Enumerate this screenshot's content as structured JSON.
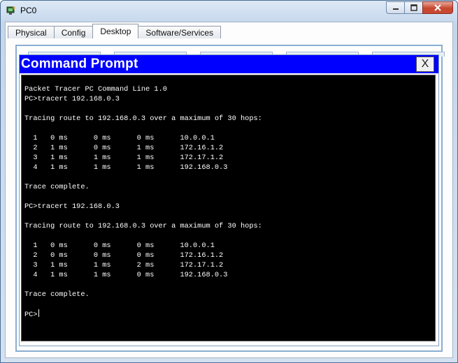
{
  "window": {
    "title": "PC0",
    "icon": "packet-tracer-pc-icon"
  },
  "tabs": [
    {
      "label": "Physical"
    },
    {
      "label": "Config"
    },
    {
      "label": "Desktop",
      "active": true
    },
    {
      "label": "Software/Services"
    }
  ],
  "command_prompt": {
    "title": "Command Prompt",
    "close_label": "X",
    "lines": [
      "Packet Tracer PC Command Line 1.0",
      "PC>tracert 192.168.0.3",
      "",
      "Tracing route to 192.168.0.3 over a maximum of 30 hops:",
      "",
      "  1   0 ms      0 ms      0 ms      10.0.0.1",
      "  2   1 ms      0 ms      1 ms      172.16.1.2",
      "  3   1 ms      1 ms      1 ms      172.17.1.2",
      "  4   1 ms      1 ms      1 ms      192.168.0.3",
      "",
      "Trace complete.",
      "",
      "PC>tracert 192.168.0.3",
      "",
      "Tracing route to 192.168.0.3 over a maximum of 30 hops:",
      "",
      "  1   0 ms      0 ms      0 ms      10.0.0.1",
      "  2   0 ms      0 ms      0 ms      172.16.1.2",
      "  3   1 ms      1 ms      2 ms      172.17.1.2",
      "  4   1 ms      1 ms      0 ms      192.168.0.3",
      "",
      "Trace complete.",
      ""
    ],
    "prompt": "PC>"
  },
  "colors": {
    "title_bar": "#0000ff",
    "terminal_bg": "#000000",
    "terminal_fg": "#ffffff"
  }
}
